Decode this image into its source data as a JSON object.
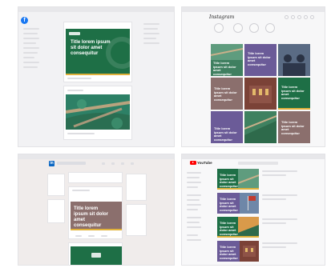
{
  "facebook": {
    "logo_glyph": "f",
    "post_text": "Title lorem ipsum sit dolor amet consequitur",
    "brand_color": "#1877f2"
  },
  "instagram": {
    "wordmark": "Instagram",
    "tile_text": "Title lorem ipsum sit dolor amet consequitur"
  },
  "linkedin": {
    "logo_glyph": "in",
    "post_text": "Title lorem ipsum sit dolor amet consequitur",
    "brand_color": "#0a66c2"
  },
  "youtube": {
    "wordmark": "YouTube",
    "tile_text": "Title lorem ipsum sit dolor amet consequitur",
    "brand_color": "#ff0000"
  },
  "colors": {
    "green": "#1e6f46",
    "gold": "#e0b13b",
    "purple": "#6b5b98",
    "brown": "#8b6f6d"
  }
}
